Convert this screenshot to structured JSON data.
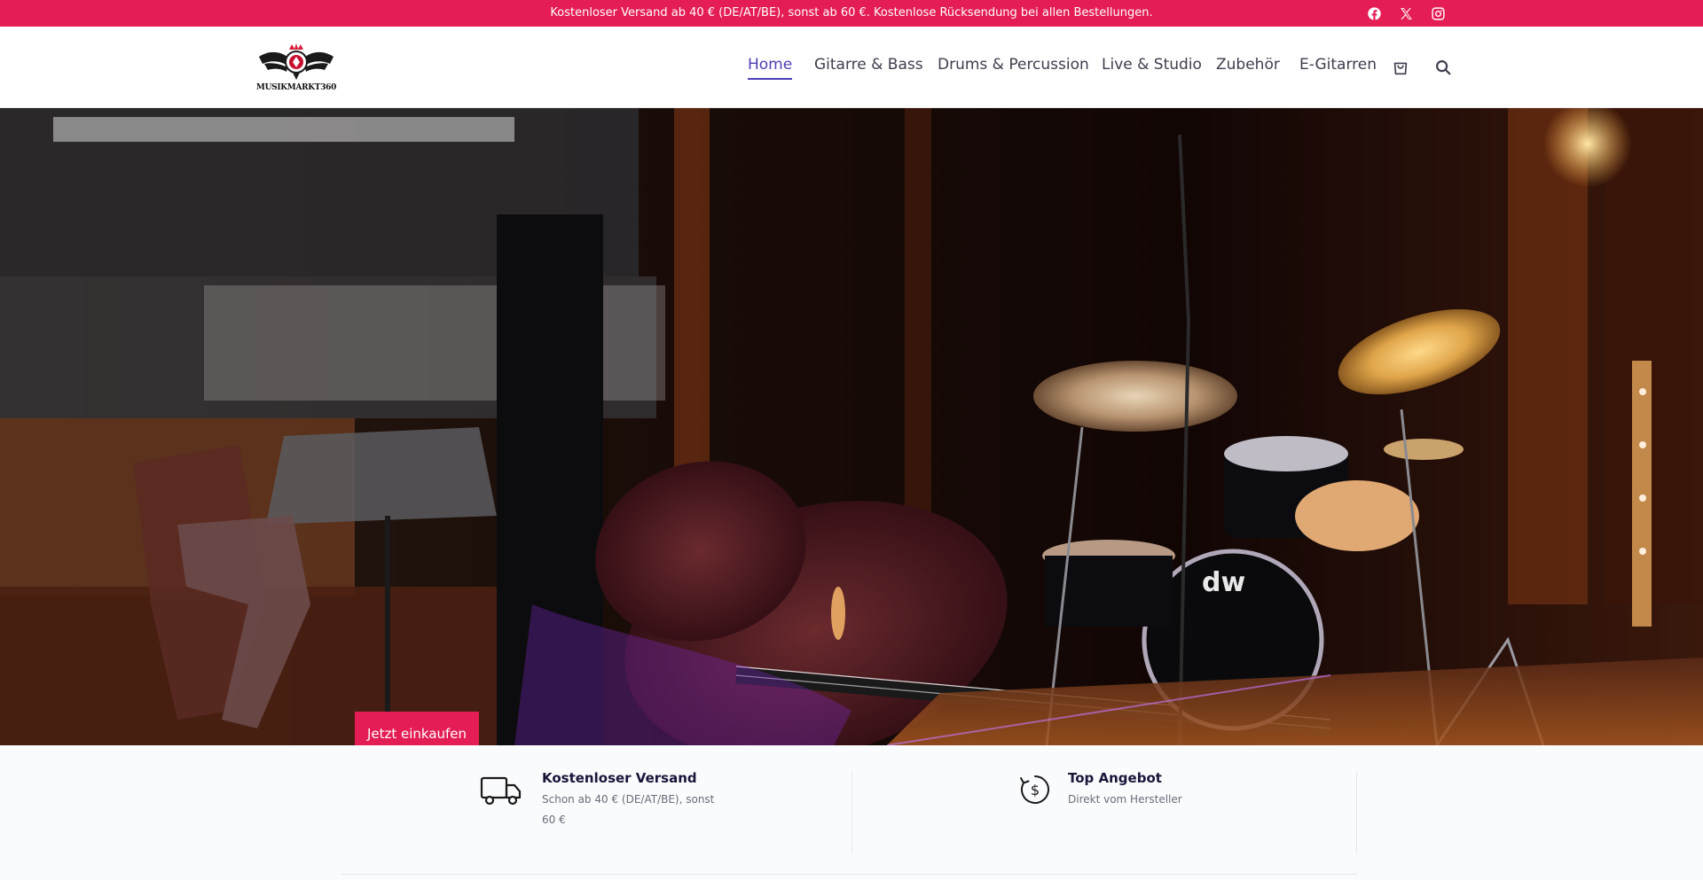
{
  "announcement": {
    "text": "Kostenloser Versand ab 40 € (DE/AT/BE), sonst ab 60 €. Kostenlose Rücksendung bei allen Bestellungen.",
    "social_icons": [
      "facebook-icon",
      "x-icon",
      "instagram-icon"
    ]
  },
  "header": {
    "logo_text": "MUSIKMARKT360",
    "nav": [
      {
        "label": "Home",
        "active": true
      },
      {
        "label": "Gitarre & Bass",
        "active": false
      },
      {
        "label": "Drums & Percussion",
        "active": false
      },
      {
        "label": "Live & Studio",
        "active": false
      },
      {
        "label": "Zubehör",
        "active": false
      },
      {
        "label": "E-Gitarren",
        "active": false
      }
    ],
    "icons": [
      "cart-icon",
      "search-icon"
    ]
  },
  "hero": {
    "cta_label": "Jetzt einkaufen"
  },
  "features": [
    {
      "icon": "truck-icon",
      "title": "Kostenloser Versand",
      "subtitle": "Schon ab 40 € (DE/AT/BE), sonst 60 €"
    },
    {
      "icon": "dollar-refresh-icon",
      "title": "Top Angebot",
      "subtitle": "Direkt vom Hersteller"
    }
  ],
  "colors": {
    "brand": "#e41d54",
    "nav_active": "#4b3fb5",
    "nav_text": "#3d3d4e",
    "feature_title": "#16163a"
  }
}
